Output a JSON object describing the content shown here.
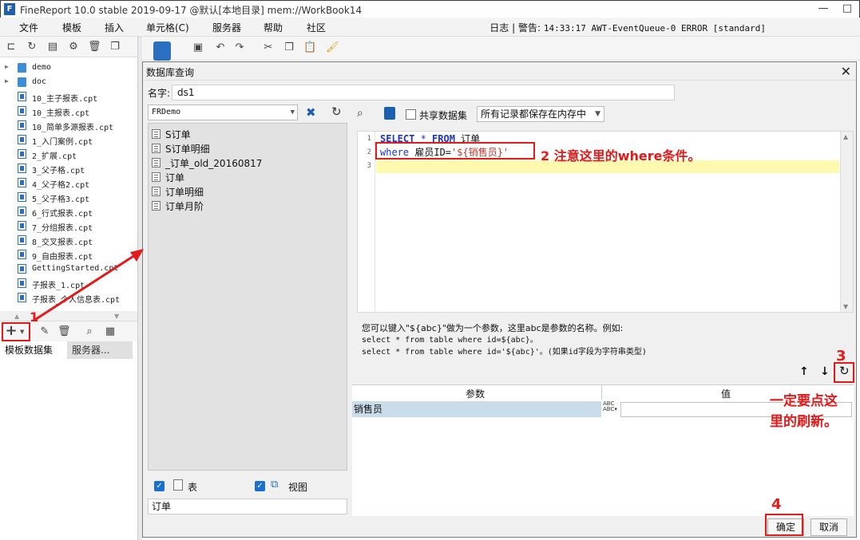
{
  "titlebar": {
    "logo": "F",
    "title": "FineReport 10.0 stable 2019-09-17 @默认[本地目录]     mem://WorkBook14",
    "minimize": "—",
    "maximize": "□"
  },
  "menu": [
    "文件",
    "模板",
    "插入",
    "单元格(C)",
    "服务器",
    "帮助",
    "社区"
  ],
  "log": {
    "label": "日志",
    "sep": "|",
    "alert": "警告:",
    "message": "14:33:17 AWT-EventQueue-0 ERROR [standard]"
  },
  "file_tree": [
    {
      "type": "folder",
      "label": "demo"
    },
    {
      "type": "folder",
      "label": "doc"
    },
    {
      "type": "file",
      "label": "10_主子报表.cpt"
    },
    {
      "type": "file",
      "label": "10_主报表.cpt"
    },
    {
      "type": "file",
      "label": "10_简单多源报表.cpt"
    },
    {
      "type": "file",
      "label": "1_入门案例.cpt"
    },
    {
      "type": "file",
      "label": "2_扩展.cpt"
    },
    {
      "type": "file",
      "label": "3_父子格.cpt"
    },
    {
      "type": "file",
      "label": "4_父子格2.cpt"
    },
    {
      "type": "file",
      "label": "5_父子格3.cpt"
    },
    {
      "type": "file",
      "label": "6_行式报表.cpt"
    },
    {
      "type": "file",
      "label": "7_分组报表.cpt"
    },
    {
      "type": "file",
      "label": "8_交叉报表.cpt"
    },
    {
      "type": "file",
      "label": "9_自由报表.cpt"
    },
    {
      "type": "file",
      "label": "GettingStarted.cpt"
    },
    {
      "type": "file",
      "label": "子报表_1.cpt"
    },
    {
      "type": "file",
      "label": "子报表_个人信息表.cpt"
    }
  ],
  "left_tabs": [
    "模板数据集",
    "服务器..."
  ],
  "dialog": {
    "title": "数据库查询",
    "close": "✕",
    "name_label": "名字:",
    "name_value": "ds1",
    "db_connection": "FRDemo",
    "tables": [
      "S订单",
      "S订单明细",
      "_订单_old_20160817",
      "订单",
      "订单明细",
      "订单月阶"
    ],
    "show_table_label": "表",
    "show_view_label": "视图",
    "search_value": "订单",
    "share_label": "共享数据集",
    "cache_option": "所有记录都保存在内存中",
    "sql": {
      "line_numbers": [
        "1",
        "2",
        "3"
      ],
      "line1": {
        "kw1": "SELECT",
        "star": " * ",
        "kw2": "FROM",
        "rest": " 订单"
      },
      "line2": {
        "kw": "where",
        "mid": " 雇员ID=",
        "str": "'${销售员}'"
      }
    },
    "help_lines": [
      "您可以键入\"${abc}\"做为一个参数，这里abc是参数的名称。例如:",
      "select * from table where id=${abc}。",
      "select * from table where id='${abc}'。(如果id字段为字符串类型)"
    ],
    "param_header": "参数",
    "value_header": "值",
    "param_rows": [
      {
        "name": "销售员",
        "value": ""
      }
    ],
    "ok": "确定",
    "cancel": "取消"
  },
  "annotations": {
    "n1": "1",
    "n2": "2 注意这里的where条件。",
    "n3": "3",
    "n3_text_line1": "一定要点这",
    "n3_text_line2": "里的刷新。",
    "n4": "4"
  },
  "colors": {
    "accent": "#1a6fd0",
    "annotation": "#e31a1a",
    "keyword": "#1a33c9"
  }
}
